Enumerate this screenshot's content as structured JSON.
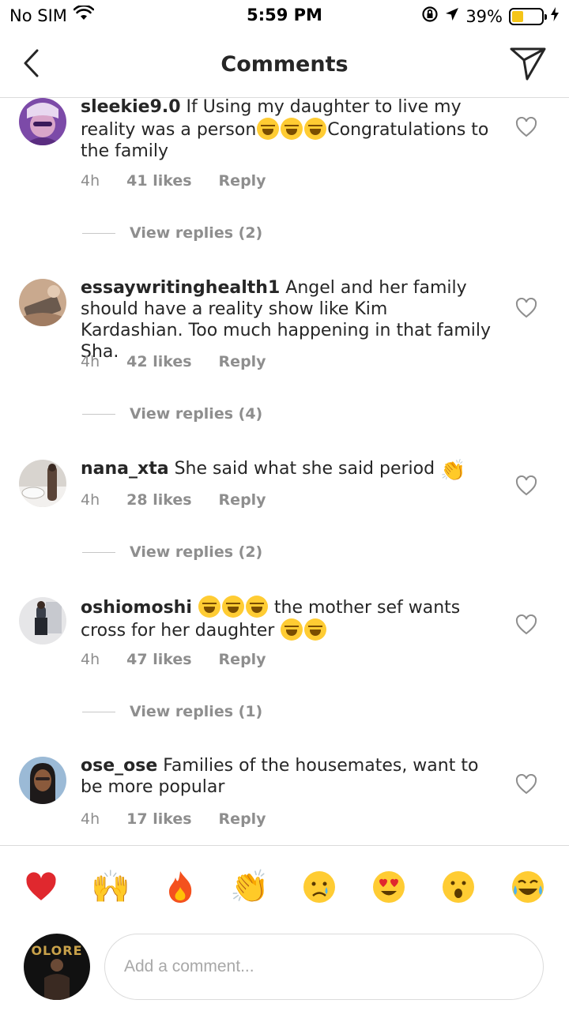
{
  "status_bar": {
    "carrier": "No SIM",
    "time": "5:59 PM",
    "battery": "39%",
    "battery_level": 0.39,
    "icons": [
      "wifi-icon",
      "rotation-lock-icon",
      "location-arrow-icon",
      "battery-icon",
      "charging-bolt-icon"
    ]
  },
  "header": {
    "title": "Comments",
    "back_icon": "chevron-left-icon",
    "send_icon": "paper-plane-icon"
  },
  "comments": [
    {
      "username": "sleekie9.0",
      "text_parts": [
        "If Using my daughter to live my reality was a person",
        "Congratulations to the family"
      ],
      "time": "4h",
      "likes": "41 likes",
      "reply": "Reply",
      "view_replies": "View replies (2)"
    },
    {
      "username": "essaywritinghealth1",
      "text": "Angel and her family should have a reality show like Kim Kardashian. Too much happening in that family Sha.",
      "time": "4h",
      "likes": "42 likes",
      "reply": "Reply",
      "view_replies": "View replies (4)"
    },
    {
      "username": "nana_xta",
      "text": "She said what she said period",
      "time": "4h",
      "likes": "28 likes",
      "reply": "Reply",
      "view_replies": "View replies (2)"
    },
    {
      "username": "oshiomoshi",
      "text_parts": [
        "the mother sef wants cross for her daughter"
      ],
      "time": "4h",
      "likes": "47 likes",
      "reply": "Reply",
      "view_replies": "View replies (1)"
    },
    {
      "username": "ose_ose",
      "text": "Families of the housemates, want to be more popular",
      "time": "4h",
      "likes": "17 likes",
      "reply": "Reply"
    }
  ],
  "reactions": [
    "red-heart",
    "raising-hands",
    "fire",
    "clapping-hands",
    "crying-face",
    "heart-eyes-face",
    "surprised-face",
    "tears-of-joy-face"
  ],
  "composer": {
    "placeholder": "Add a comment...",
    "avatar_logo": "OLORE"
  },
  "colors": {
    "text": "#262626",
    "secondary": "#8e8e8e",
    "divider": "#dbdbdb",
    "battery": "#f5c518",
    "heart_reaction": "#e0282e"
  }
}
